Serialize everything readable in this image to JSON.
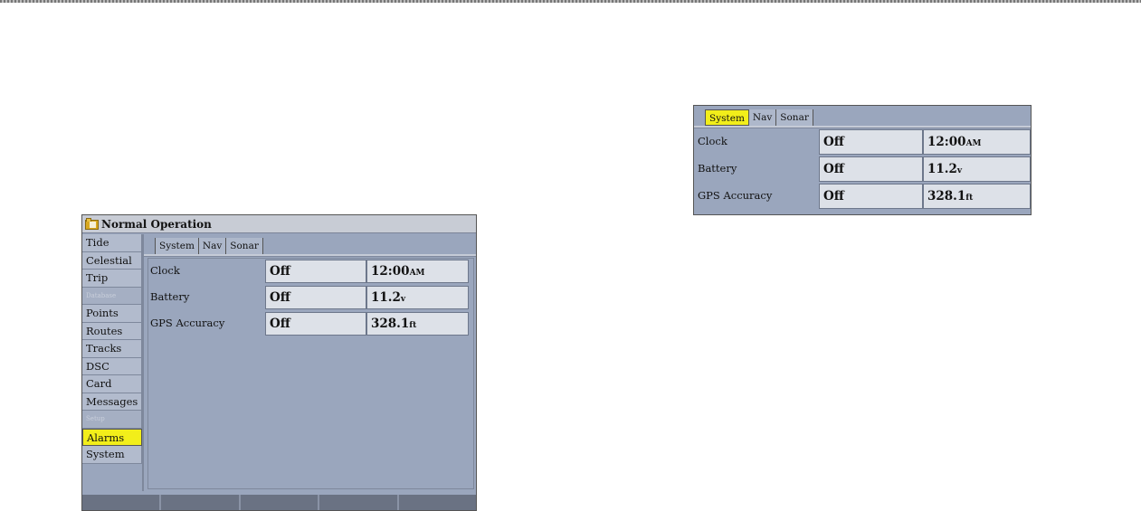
{
  "window": {
    "title": "Normal Operation",
    "icon": "folder-icon"
  },
  "sidebar": {
    "items": [
      {
        "label": "Tide",
        "type": "item"
      },
      {
        "label": "Celestial",
        "type": "item"
      },
      {
        "label": "Trip",
        "type": "item"
      },
      {
        "label": "Database",
        "type": "section"
      },
      {
        "label": "Points",
        "type": "item"
      },
      {
        "label": "Routes",
        "type": "item"
      },
      {
        "label": "Tracks",
        "type": "item"
      },
      {
        "label": "DSC",
        "type": "item"
      },
      {
        "label": "Card",
        "type": "item"
      },
      {
        "label": "Messages",
        "type": "item"
      },
      {
        "label": "Setup",
        "type": "section"
      },
      {
        "label": "Alarms",
        "type": "item",
        "selected": true
      },
      {
        "label": "System",
        "type": "item"
      }
    ]
  },
  "tabs": [
    {
      "label": "System",
      "selected": true
    },
    {
      "label": "Nav"
    },
    {
      "label": "Sonar"
    }
  ],
  "alarms": [
    {
      "label": "Clock",
      "status": "Off",
      "value": "12:00",
      "unit": "AM"
    },
    {
      "label": "Battery",
      "status": "Off",
      "value": "11.2",
      "unit": "v"
    },
    {
      "label": "GPS Accuracy",
      "status": "Off",
      "value": "328.1",
      "unit": "ft"
    }
  ],
  "softkeys": [
    "",
    "",
    "",
    "",
    ""
  ],
  "colors": {
    "highlight": "#f2ee1a",
    "background": "#9aa6bd",
    "field": "#dde1e8"
  }
}
